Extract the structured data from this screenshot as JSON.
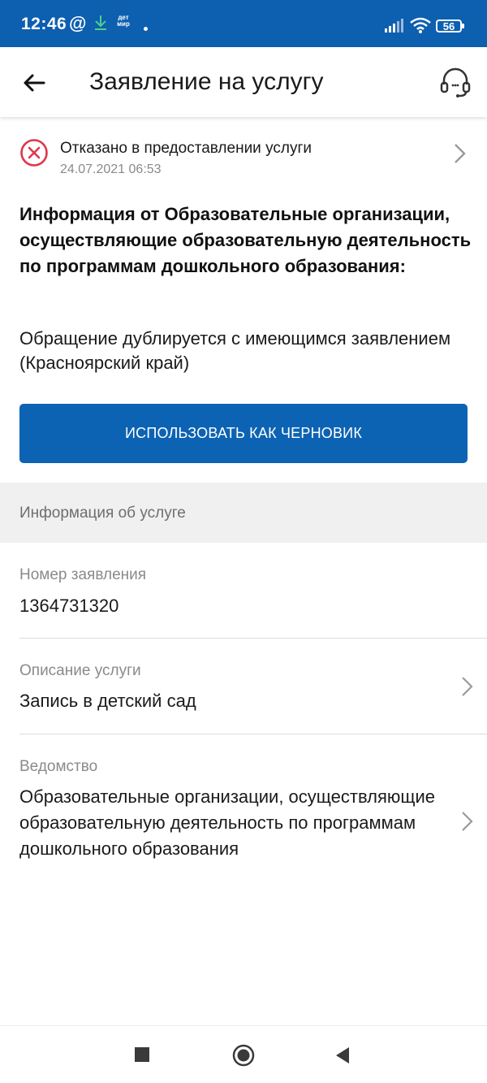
{
  "status_bar": {
    "time": "12:46",
    "at_symbol": "@",
    "detmir_label": "дет мир",
    "battery": "56",
    "icons": [
      "download-icon",
      "signal-icon",
      "wifi-icon",
      "battery-icon"
    ]
  },
  "app_bar": {
    "title": "Заявление на услугу",
    "back_icon": "arrow-left-icon",
    "support_icon": "headset-icon"
  },
  "application_status": {
    "text": "Отказано в предоставлении услуги",
    "date": "24.07.2021 06:53",
    "icon": "reject-circle-icon",
    "color": "#e0364a"
  },
  "info": {
    "heading": "Информация от Образовательные организации, осуществляющие образовательную деятельность по программам дошкольного образования:",
    "body": "Обращение дублируется с имеющимся заявлением (Красноярский край)"
  },
  "draft_button": {
    "label": "ИСПОЛЬЗОВАТЬ КАК ЧЕРНОВИК",
    "color": "#0d63b3"
  },
  "service_section": {
    "header": "Информация об услуге",
    "fields": [
      {
        "label": "Номер заявления",
        "value": "1364731320"
      },
      {
        "label": "Описание услуги",
        "value": "Запись в детский сад"
      },
      {
        "label": "Ведомство",
        "value": "Образовательные организации, осуществляющие образовательную деятельность по программам дошкольного образования"
      }
    ]
  },
  "colors": {
    "status_bar_bg": "#0d5fb0",
    "accent": "#0d63b3",
    "section_bg": "#f0f0f0"
  }
}
